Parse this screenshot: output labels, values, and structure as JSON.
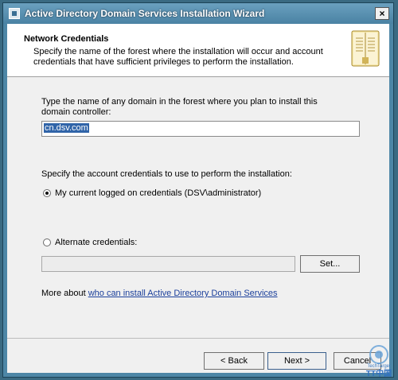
{
  "window": {
    "title": "Active Directory Domain Services Installation Wizard",
    "close_label": "×"
  },
  "header": {
    "title": "Network Credentials",
    "description": "Specify the name of the forest where the installation will occur and account credentials that have sufficient privileges to perform the installation."
  },
  "domain": {
    "prompt": "Type the name of any domain in the forest where you plan to install this domain controller:",
    "value": "cn.dsv.com"
  },
  "credentials": {
    "prompt": "Specify the account credentials to use to perform the installation:",
    "current_label": "My current logged on credentials (DSV\\administrator)",
    "current_selected": true,
    "alternate_label": "Alternate credentials:",
    "alternate_selected": false,
    "set_button": "Set..."
  },
  "more_info": {
    "prefix": "More about ",
    "link": "who can install Active Directory Domain Services"
  },
  "footer": {
    "back": "< Back",
    "next": "Next >",
    "cancel": "Cancel"
  },
  "watermark": {
    "text": "TechTarget",
    "subtext": "TT中国"
  },
  "colors": {
    "title_bar": "#4a82a3",
    "link": "#1b3f9b",
    "selection": "#3064a8"
  },
  "icons": {
    "window_icon": "wizard-window-icon",
    "header_icon": "book-icon"
  }
}
